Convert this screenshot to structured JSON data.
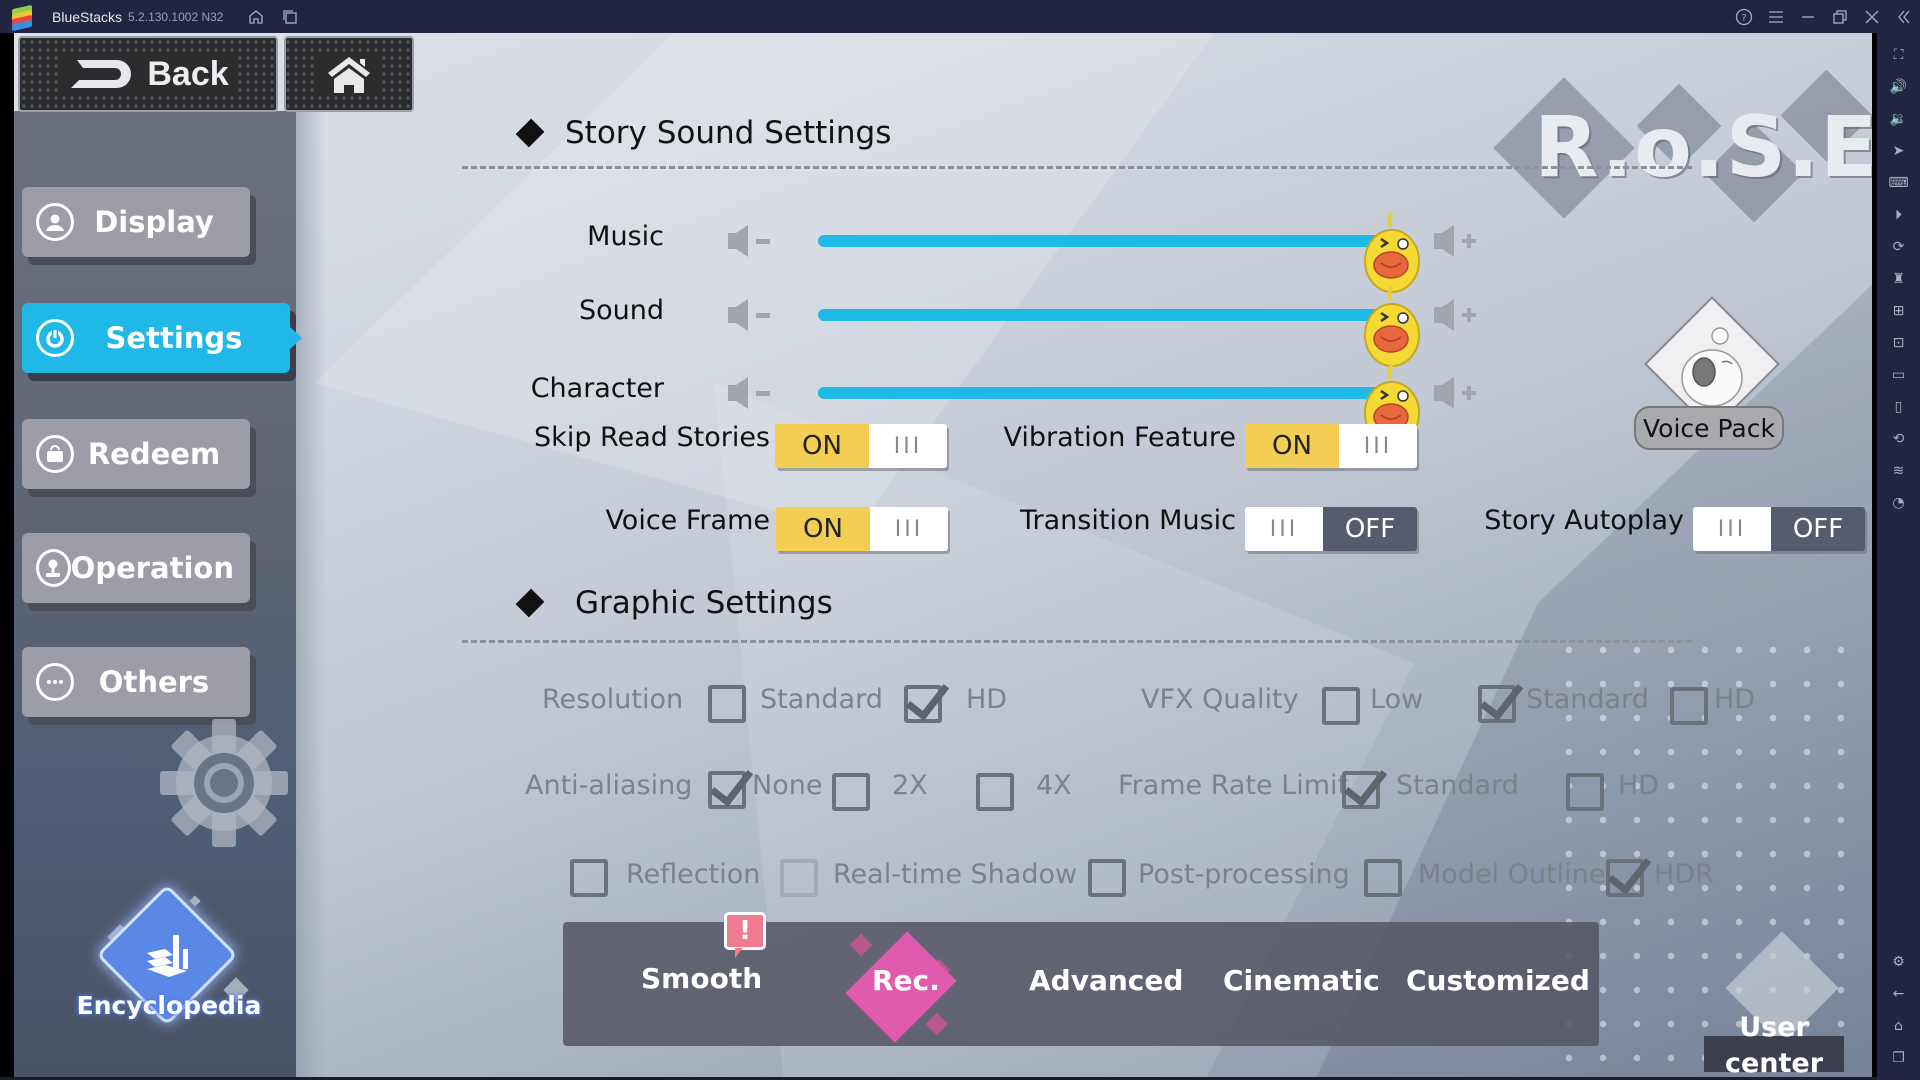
{
  "titlebar": {
    "app_name": "BlueStacks",
    "version": "5.2.130.1002 N32",
    "left_icons": [
      "home-icon",
      "multi-instance-icon"
    ],
    "right_icons": [
      "help-icon",
      "menu-icon",
      "minimize-icon",
      "restore-icon",
      "close-icon",
      "collapse-sidebar-icon"
    ]
  },
  "right_toolbar": {
    "icons": [
      "fullscreen-icon",
      "volume-up-icon",
      "volume-down-icon",
      "pointer-icon",
      "keyboard-icon",
      "macro-record-icon",
      "sync-icon",
      "performance-icon",
      "install-apk-icon",
      "screenshot-icon",
      "folder-icon",
      "multi-window-icon",
      "rotate-icon",
      "layers-icon",
      "eco-mode-icon"
    ],
    "bottom_icons": [
      "settings-icon",
      "back-arrow-icon",
      "android-home-icon",
      "recent-apps-icon"
    ]
  },
  "nav": {
    "back_label": "Back",
    "home_icon": "home-icon"
  },
  "menu": {
    "items": [
      {
        "label": "Display",
        "icon": "display-icon",
        "active": false
      },
      {
        "label": "Settings",
        "icon": "power-icon",
        "active": true
      },
      {
        "label": "Redeem",
        "icon": "bag-icon",
        "active": false
      },
      {
        "label": "Operation",
        "icon": "joystick-icon",
        "active": false
      },
      {
        "label": "Others",
        "icon": "ellipsis-icon",
        "active": false
      }
    ],
    "encyclopedia_label": "Encyclopedia"
  },
  "logo": {
    "text": "R.o.S.E"
  },
  "sound": {
    "title": "Story Sound Settings",
    "sliders": [
      {
        "label": "Music",
        "value_fraction": 1.0
      },
      {
        "label": "Sound",
        "value_fraction": 1.0
      },
      {
        "label": "Character",
        "value_fraction": 1.0
      }
    ],
    "toggles": [
      {
        "label": "Skip Read Stories",
        "state": "ON"
      },
      {
        "label": "Vibration Feature",
        "state": "ON"
      },
      {
        "label": "Voice Frame",
        "state": "ON"
      },
      {
        "label": "Transition Music",
        "state": "OFF"
      },
      {
        "label": "Story Autoplay",
        "state": "OFF"
      }
    ],
    "toggle_bars": "III",
    "on_text": "ON",
    "off_text": "OFF"
  },
  "voice_pack": {
    "label": "Voice Pack"
  },
  "graphics": {
    "title": "Graphic Settings",
    "resolution": {
      "label": "Resolution",
      "options": [
        {
          "label": "Standard",
          "checked": false
        },
        {
          "label": "HD",
          "checked": true
        }
      ]
    },
    "vfx": {
      "label": "VFX Quality",
      "options": [
        {
          "label": "Low",
          "checked": false
        },
        {
          "label": "Standard",
          "checked": true
        },
        {
          "label": "HD",
          "checked": false
        }
      ]
    },
    "anti_aliasing": {
      "label": "Anti-aliasing",
      "options": [
        {
          "label": "None",
          "checked": true
        },
        {
          "label": "2X",
          "checked": false
        },
        {
          "label": "4X",
          "checked": false
        }
      ]
    },
    "frame_rate": {
      "label": "Frame Rate Limit",
      "options": [
        {
          "label": "Standard",
          "checked": true
        },
        {
          "label": "HD",
          "checked": false
        }
      ]
    },
    "features": [
      {
        "label": "Reflection",
        "checked": false
      },
      {
        "label": "Real-time Shadow",
        "checked": false
      },
      {
        "label": "Post-processing",
        "checked": false
      },
      {
        "label": "Model Outline",
        "checked": false
      },
      {
        "label": "HDR",
        "checked": true
      }
    ]
  },
  "presets": {
    "items": [
      "Smooth",
      "Rec.",
      "Advanced",
      "Cinematic",
      "Customized"
    ],
    "selected": "Rec.",
    "alert_glyph": "!"
  },
  "user_center": {
    "label": "User center"
  },
  "colors": {
    "accent_blue": "#20b8e6",
    "toggle_on": "#f4cd55",
    "toggle_off": "#565c70",
    "rec_pink": "#e05aad",
    "titlebar_bg": "#222541"
  }
}
